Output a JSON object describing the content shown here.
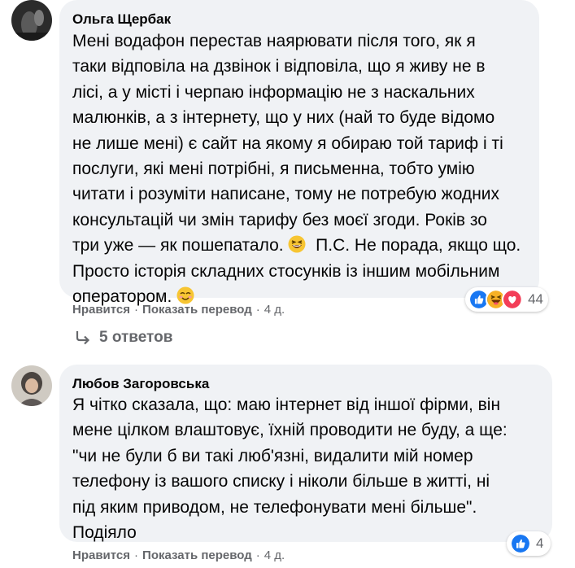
{
  "comments": [
    {
      "author": "Ольга Щербак",
      "lines": [
        "Мені водафон перестав наярювати після того, як я",
        "таки відповіла на дзвінок і відповіла, що я живу не в",
        "лісі, а у місті і черпаю інформацію не з наскальних",
        "малюнків, а з інтернету, що у них (най то буде відомо",
        "не лише мені) є сайт на якому я обираю той тариф і ті",
        "послуги, які мені потрібні, я письменна, тобто умію",
        "читати і розуміти написане, тому не потребую жодних",
        "консультацій чи змін тарифу без моєї згоди. Років зо",
        "три уже — як пошепатало.",
        "П.С. Не порада, якщо що.",
        "Просто історія складних стосунків із іншим мобільним",
        "оператором."
      ],
      "emojis": [
        "laughing-emoji",
        "smiling-emoji"
      ],
      "reactions": [
        "like",
        "haha",
        "love"
      ],
      "reaction_count": "44",
      "like_label": "Нравится",
      "translate_label": "Показать перевод",
      "time": "4 д.",
      "replies_label": "5 ответов"
    },
    {
      "author": "Любов Загоровська",
      "lines": [
        "Я чітко сказала, що: маю інтернет від іншої фірми, він",
        "мене цілком влаштовує, їхній проводити не буду, а ще:",
        "\"чи не були б ви такі люб'язні, видалити мій номер",
        "телефону із вашого списку і ніколи більше в житті, ні",
        "під яким приводом, не телефонувати мені більше\".",
        "Подіяло"
      ],
      "reactions": [
        "like"
      ],
      "reaction_count": "4",
      "like_label": "Нравится",
      "translate_label": "Показать перевод",
      "time": "4 д."
    }
  ],
  "separator": "·",
  "colors": {
    "bubble": "#f0f2f5",
    "secondary_text": "#65676b",
    "like_blue": "#1877f2",
    "love_red": "#f33e58",
    "haha_yellow": "#f7b125"
  }
}
